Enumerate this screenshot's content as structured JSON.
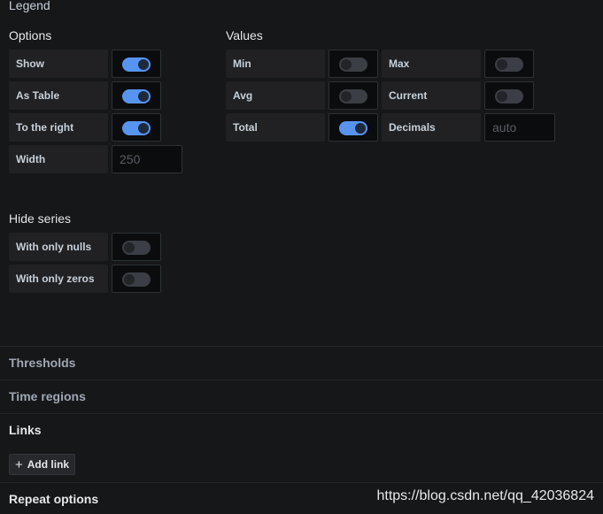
{
  "legend": {
    "title": "Legend"
  },
  "options": {
    "title": "Options",
    "rows": [
      {
        "label": "Show",
        "on": true
      },
      {
        "label": "As Table",
        "on": true
      },
      {
        "label": "To the right",
        "on": true
      }
    ],
    "width": {
      "label": "Width",
      "placeholder": "250"
    }
  },
  "values": {
    "title": "Values",
    "min": {
      "label": "Min",
      "on": false
    },
    "max": {
      "label": "Max",
      "on": false
    },
    "avg": {
      "label": "Avg",
      "on": false
    },
    "current": {
      "label": "Current",
      "on": false
    },
    "total": {
      "label": "Total",
      "on": true
    },
    "decimals": {
      "label": "Decimals",
      "placeholder": "auto"
    }
  },
  "hide_series": {
    "title": "Hide series",
    "nulls": {
      "label": "With only nulls",
      "on": false
    },
    "zeros": {
      "label": "With only zeros",
      "on": false
    }
  },
  "sections": {
    "thresholds": "Thresholds",
    "time_regions": "Time regions",
    "links": "Links",
    "repeat_options": "Repeat options"
  },
  "links": {
    "add_label": "Add link"
  },
  "watermark": "https://blog.csdn.net/qq_42036824",
  "colors": {
    "accent": "#5794f2",
    "background": "#161719",
    "label_bg": "#212124"
  },
  "icons": {
    "add": "plus-icon"
  }
}
